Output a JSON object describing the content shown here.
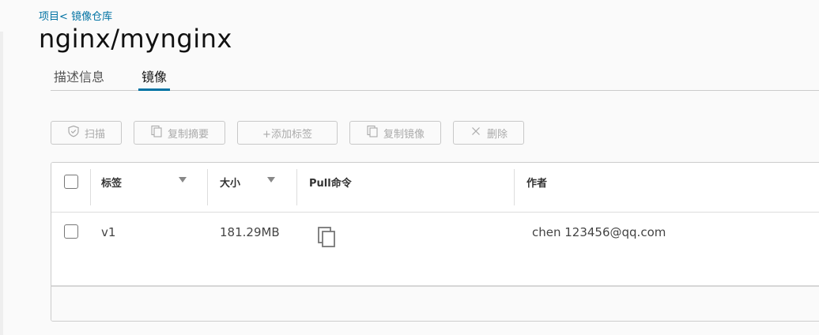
{
  "breadcrumb": {
    "project": "项目",
    "sep": "<",
    "repo": "镜像仓库"
  },
  "page_title": "nginx/mynginx",
  "tabs": [
    {
      "label": "描述信息"
    },
    {
      "label": "镜像"
    }
  ],
  "toolbar": {
    "scan": "扫描",
    "copy_digest": "复制摘要",
    "add_tag": "+添加标签",
    "copy_image": "复制镜像",
    "delete": "删除"
  },
  "table": {
    "columns": [
      "标签",
      "大小",
      "Pull命令",
      "作者"
    ],
    "rows": [
      {
        "tag": "v1",
        "size": "181.29MB",
        "author": "chen 123456@qq.com"
      }
    ]
  },
  "colors": {
    "accent": "#0072a3",
    "disabled_text": "#aaaaaa"
  }
}
